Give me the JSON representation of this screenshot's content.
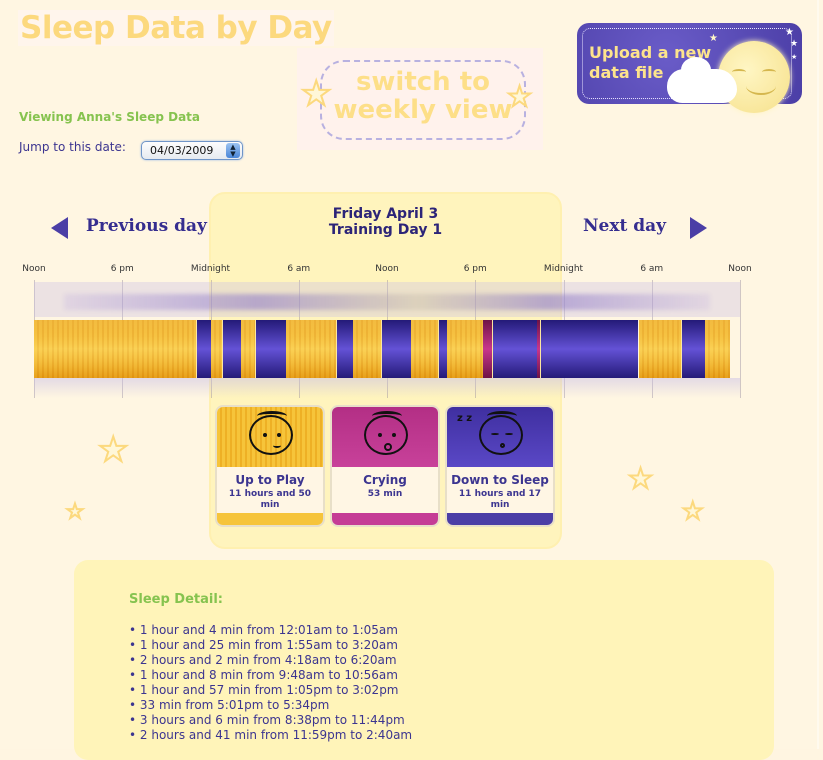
{
  "page": {
    "title": "Sleep Data by Day",
    "viewing_label": "Viewing Anna's Sleep Data",
    "jump_label": "Jump to this date:",
    "date_value": "04/03/2009"
  },
  "buttons": {
    "weekly_view": "switch to weekly view",
    "upload": "Upload a new data file"
  },
  "day": {
    "title_line1": "Friday April 3",
    "title_line2": "Training Day 1",
    "previous_label": "Previous day",
    "next_label": "Next day"
  },
  "timeline": {
    "ticks": [
      "Noon",
      "6 pm",
      "Midnight",
      "6 am",
      "Noon",
      "6 pm",
      "Midnight",
      "6 am",
      "Noon"
    ],
    "range_hours": 48,
    "segments": [
      {
        "state": "awake",
        "start_h": 0.0,
        "end_h": 11.0
      },
      {
        "state": "sleep",
        "start_h": 11.0,
        "end_h": 12.02
      },
      {
        "state": "awake",
        "start_h": 12.02,
        "end_h": 12.75
      },
      {
        "state": "sleep",
        "start_h": 12.75,
        "end_h": 14.08
      },
      {
        "state": "awake",
        "start_h": 14.08,
        "end_h": 15.05
      },
      {
        "state": "sleep",
        "start_h": 15.05,
        "end_h": 17.13
      },
      {
        "state": "awake",
        "start_h": 17.13,
        "end_h": 20.5
      },
      {
        "state": "sleep",
        "start_h": 20.5,
        "end_h": 21.7
      },
      {
        "state": "awake",
        "start_h": 21.7,
        "end_h": 23.6
      },
      {
        "state": "sleep",
        "start_h": 23.6,
        "end_h": 25.6
      },
      {
        "state": "awake",
        "start_h": 25.6,
        "end_h": 27.5
      },
      {
        "state": "sleep",
        "start_h": 27.5,
        "end_h": 28.05
      },
      {
        "state": "awake",
        "start_h": 28.05,
        "end_h": 30.5
      },
      {
        "state": "cry",
        "start_h": 30.5,
        "end_h": 31.15
      },
      {
        "state": "sleep",
        "start_h": 31.15,
        "end_h": 34.2
      },
      {
        "state": "cry",
        "start_h": 34.2,
        "end_h": 34.4
      },
      {
        "state": "sleep",
        "start_h": 34.4,
        "end_h": 41.1
      },
      {
        "state": "awake",
        "start_h": 41.1,
        "end_h": 44.0
      },
      {
        "state": "sleep",
        "start_h": 44.0,
        "end_h": 45.6
      },
      {
        "state": "awake",
        "start_h": 45.6,
        "end_h": 47.3
      }
    ]
  },
  "legend": [
    {
      "name": "Up to Play",
      "duration": "11 hours and 50 min",
      "color": "#f5be2c"
    },
    {
      "name": "Crying",
      "duration": "53 min",
      "color": "#c53c96"
    },
    {
      "name": "Down to Sleep",
      "duration": "11 hours and 17 min",
      "color": "#4b3ea6"
    }
  ],
  "sleep_detail": {
    "title": "Sleep Detail:",
    "items": [
      "1 hour and 4 min from 12:01am to 1:05am",
      "1 hour and 25 min from 1:55am to 3:20am",
      "2 hours and 2 min from 4:18am to 6:20am",
      "1 hour and 8 min from 9:48am to 10:56am",
      "1 hour and 57 min from 1:05pm to 3:02pm",
      "33 min from 5:01pm to 5:34pm",
      "3 hours and 6 min from 8:38pm to 11:44pm",
      "2 hours and 41 min from 11:59pm to 2:40am"
    ]
  },
  "colors": {
    "title": "#fcd97e",
    "accent_green": "#86c34f",
    "text_purple": "#3c3590",
    "awake": "#f5b82a",
    "sleep": "#4b3ea6",
    "cry": "#c8368c"
  }
}
